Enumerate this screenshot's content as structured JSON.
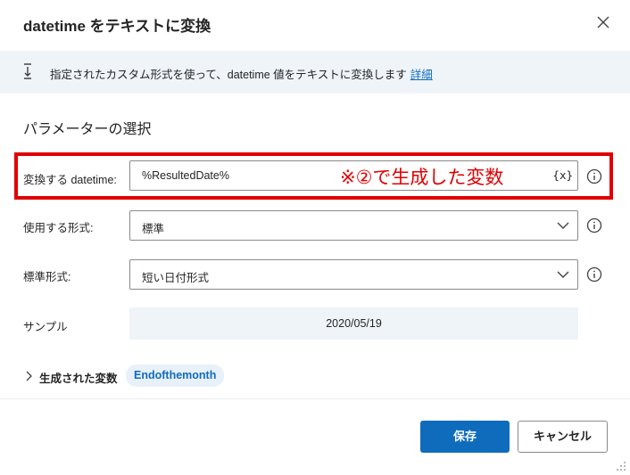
{
  "dialog": {
    "title": "datetime をテキストに変換",
    "close_icon": "close-icon"
  },
  "info": {
    "icon": "convert-icon",
    "text": "指定されたカスタム形式を使って、datetime 値をテキストに変換します",
    "link": "詳細"
  },
  "section_title": "パラメーターの選択",
  "params": {
    "datetime": {
      "label": "変換する datetime:",
      "value": "%ResultedDate%",
      "var_button": "{x}"
    },
    "format_type": {
      "label": "使用する形式:",
      "value": "標準"
    },
    "standard_format": {
      "label": "標準形式:",
      "value": "短い日付形式"
    },
    "sample": {
      "label": "サンプル",
      "value": "2020/05/19"
    }
  },
  "annotation": {
    "text": "※②で生成した変数",
    "color": "#e00000"
  },
  "generated": {
    "label": "生成された変数",
    "variable": "Endofthemonth"
  },
  "buttons": {
    "save": "保存",
    "cancel": "キャンセル"
  },
  "colors": {
    "accent": "#0f6cbd",
    "info_background": "#eff4f9"
  }
}
